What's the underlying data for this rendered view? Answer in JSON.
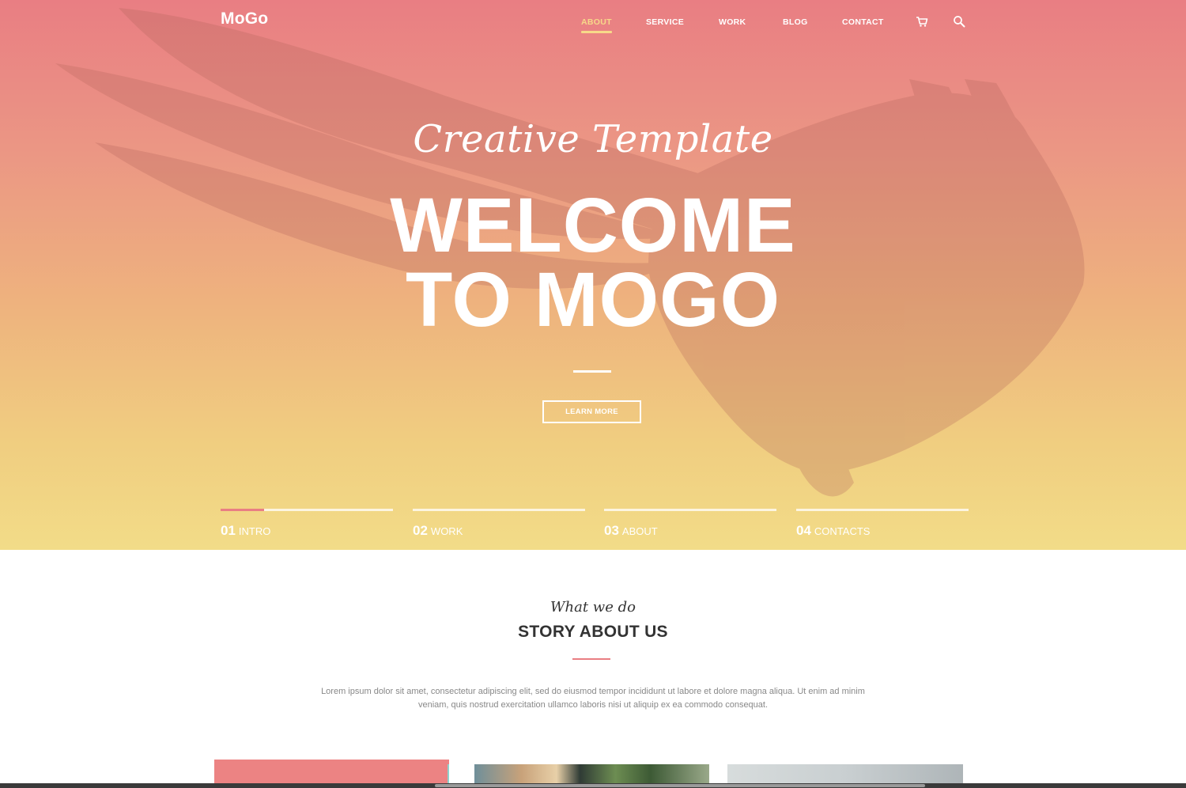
{
  "brand": {
    "logo": "MoGo"
  },
  "nav": {
    "items": [
      {
        "label": "ABOUT",
        "active": true
      },
      {
        "label": "SERVICE"
      },
      {
        "label": "WORK"
      },
      {
        "label": "BLOG"
      },
      {
        "label": "CONTACT"
      }
    ],
    "icons": [
      "cart-icon",
      "search-icon"
    ]
  },
  "hero": {
    "subtitle": "Creative Template",
    "headline_line1": "WELCOME",
    "headline_line2": "TO MOGO",
    "button_label": "LEARN MORE",
    "slides": [
      {
        "number": "01",
        "label": "INTRO",
        "progress": 0.25
      },
      {
        "number": "02",
        "label": "WORK"
      },
      {
        "number": "03",
        "label": "ABOUT"
      },
      {
        "number": "04",
        "label": "CONTACTS"
      }
    ]
  },
  "story": {
    "kicker": "What we do",
    "title": "STORY ABOUT US",
    "text_line1": "Lorem ipsum dolor sit amet, consectetur adipiscing elit, sed do eiusmod tempor incididunt ut labore et dolore magna aliqua. Ut enim ad minim",
    "text_line2": "veniam, quis nostrud exercitation ullamco laboris nisi ut aliquip ex ea commodo consequat."
  },
  "colors": {
    "gradient_top": "#e97e83",
    "gradient_bottom": "#f2dc88",
    "accent_active": "#f7d989",
    "accent_pink": "#e97e83"
  }
}
